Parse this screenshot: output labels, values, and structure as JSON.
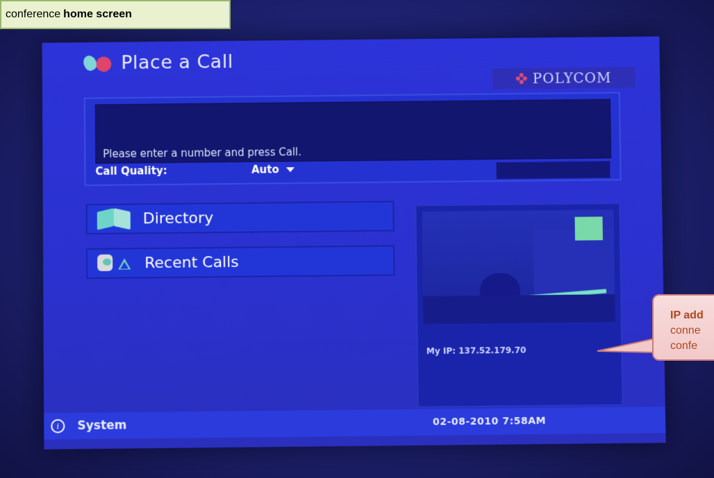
{
  "annotation": {
    "caption_prefix": "conference",
    "caption_bold": "home screen",
    "callout_line1": "IP add",
    "callout_line2": "conne",
    "callout_line3": "confe"
  },
  "screen": {
    "title": "Place a Call",
    "brand": "POLYCOM",
    "dial": {
      "hint": "Please enter a number and press Call.",
      "quality_label": "Call Quality:",
      "quality_value": "Auto"
    },
    "menu": {
      "directory": "Directory",
      "recent_calls": "Recent Calls"
    },
    "video": {
      "my_ip": "My IP: 137.52.179.70"
    },
    "status_bar": {
      "system_label": "System",
      "datetime": "02-08-2010 7:58AM"
    }
  },
  "icons": {
    "title": "phone-handset-icon",
    "brand": "polycom-logo-icon",
    "directory": "book-icon",
    "recent_calls": "phone-recent-icon",
    "quality": "caret-down-icon",
    "system": "info-icon"
  },
  "colors": {
    "screen_blue": "#2b31cf",
    "panel_blue": "#2236d8",
    "caption_bg": "#e9f1cf",
    "callout_bg": "#f2c9c9",
    "callout_text": "#b04820",
    "polycom_mark": "#e04b73"
  }
}
